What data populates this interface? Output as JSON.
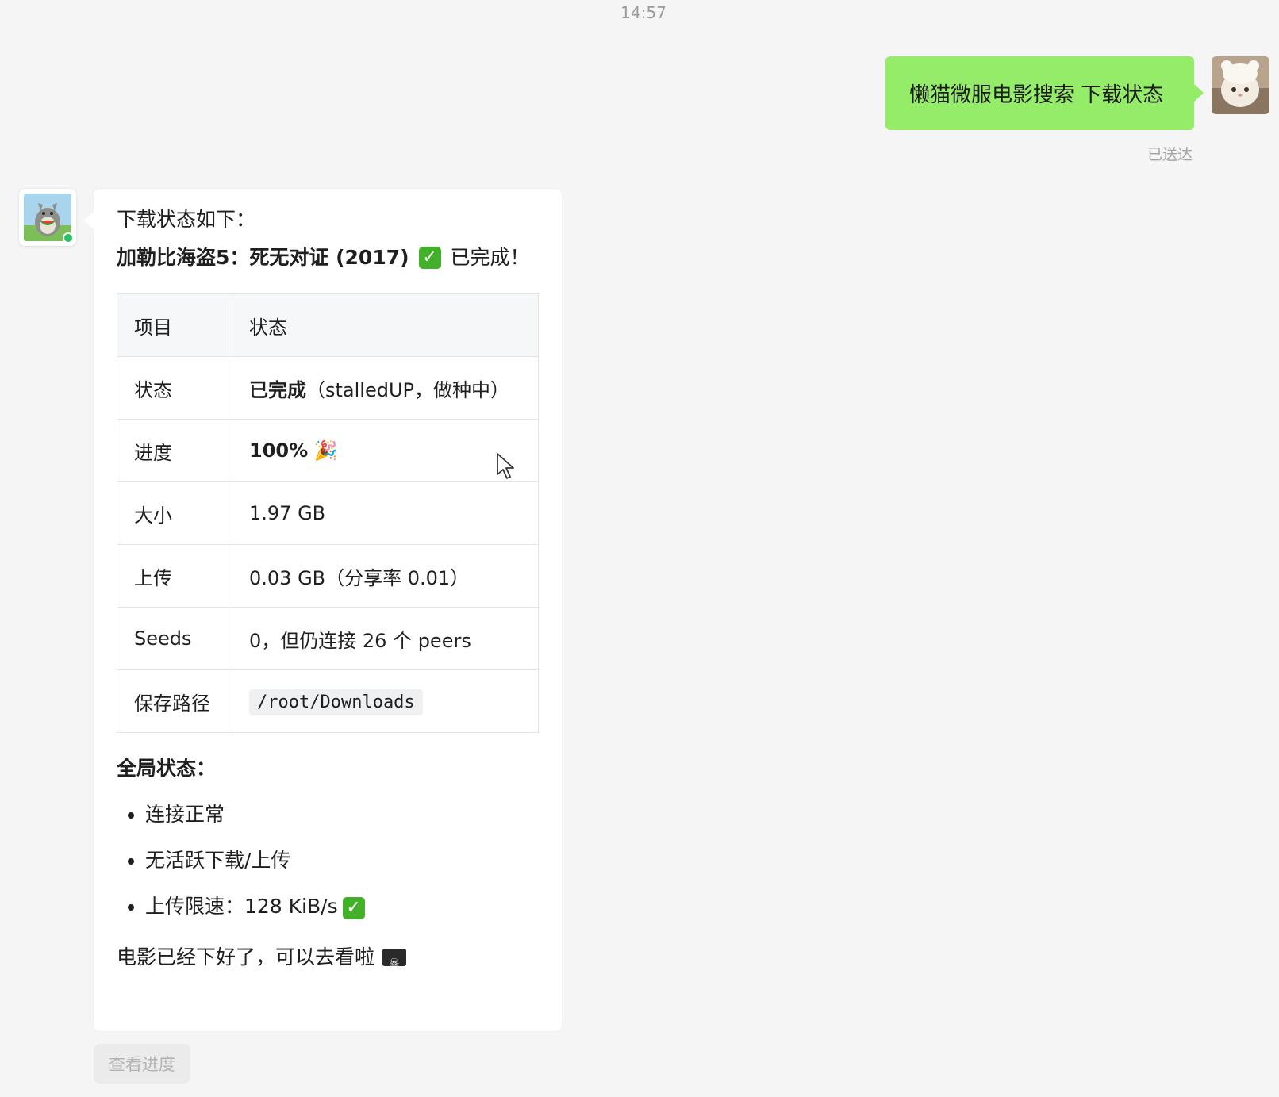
{
  "timestamp": "14:57",
  "outgoing": {
    "text": "懒猫微服电影搜索 下载状态",
    "status": "已送达"
  },
  "incoming": {
    "intro": "下载状态如下：",
    "title_bold": "加勒比海盗5：死无对证 (2017)",
    "title_suffix": "已完成！",
    "table": {
      "headers": [
        "项目",
        "状态"
      ],
      "rows": [
        {
          "label": "状态",
          "value_bold": "已完成",
          "value": "（stalledUP，做种中）"
        },
        {
          "label": "进度",
          "value_bold": "100%",
          "value": "🎉"
        },
        {
          "label": "大小",
          "value_bold": "",
          "value": "1.97 GB"
        },
        {
          "label": "上传",
          "value_bold": "",
          "value": "0.03 GB（分享率 0.01）"
        },
        {
          "label": "Seeds",
          "value_bold": "",
          "value": "0，但仍连接 26 个 peers"
        },
        {
          "label": "保存路径",
          "value_bold": "",
          "value": "/root/Downloads"
        }
      ]
    },
    "global_title": "全局状态：",
    "global_items": [
      "连接正常",
      "无活跃下载/上传",
      "上传限速：128 KiB/s"
    ],
    "closing": "电影已经下好了，可以去看啦"
  },
  "progress_button": "查看进度",
  "colors": {
    "outgoing_bubble": "#95ec69",
    "background": "#f5f5f5",
    "online_dot": "#22c55e",
    "check": "#43b02a"
  }
}
